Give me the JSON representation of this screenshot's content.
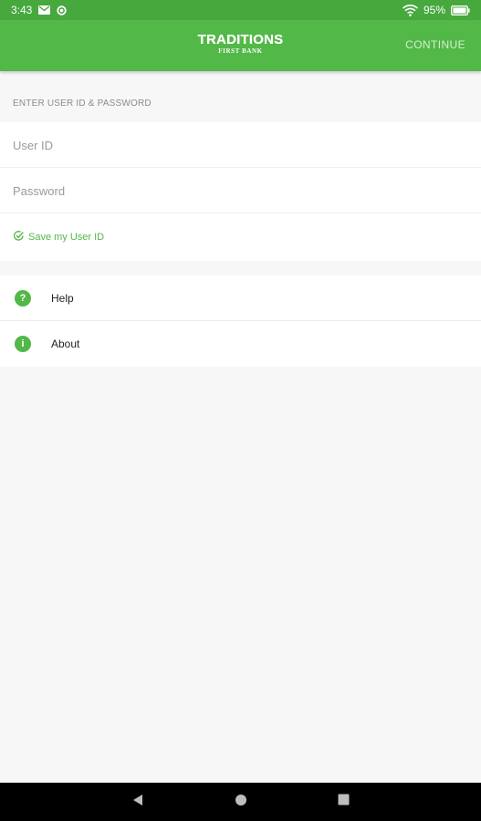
{
  "status_bar": {
    "time": "3:43",
    "battery": "95%",
    "icons": [
      "mail-icon",
      "circle-notification-icon",
      "wifi-icon",
      "battery-icon"
    ]
  },
  "app_bar": {
    "logo_main": "TRADITIONS",
    "logo_sub": "FIRST BANK",
    "continue_label": "CONTINUE"
  },
  "login": {
    "section_header": "ENTER USER ID & PASSWORD",
    "user_id_placeholder": "User ID",
    "user_id_value": "",
    "password_placeholder": "Password",
    "password_value": "",
    "save_user_id_label": "Save my User ID",
    "save_user_id_checked": true
  },
  "menu": {
    "items": [
      {
        "label": "Help",
        "icon": "help-icon",
        "glyph": "?"
      },
      {
        "label": "About",
        "icon": "info-icon",
        "glyph": "i"
      }
    ]
  },
  "nav_bar": {
    "buttons": [
      "back-icon",
      "home-icon",
      "recents-icon"
    ]
  },
  "colors": {
    "accent": "#52b848",
    "status_bar": "#46a83d",
    "background": "#f7f7f7",
    "nav_bar": "#000000"
  }
}
